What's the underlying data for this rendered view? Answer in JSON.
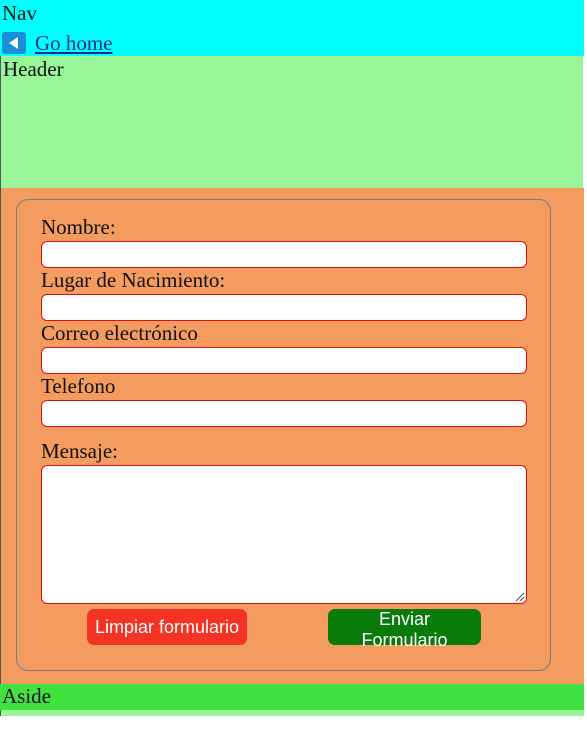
{
  "nav": {
    "title": "Nav",
    "home_link": {
      "icon": "back-arrow-icon",
      "label": "Go home"
    }
  },
  "header": {
    "title": "Header"
  },
  "form": {
    "fields": [
      {
        "label": "Nombre:",
        "value": ""
      },
      {
        "label": "Lugar de Nacimiento:",
        "value": ""
      },
      {
        "label": "Correo electrónico",
        "value": ""
      },
      {
        "label": "Telefono",
        "value": ""
      }
    ],
    "message": {
      "label": "Mensaje:",
      "value": ""
    },
    "buttons": {
      "clear_label": "Limpiar formulario",
      "send_label": "Enviar Formulario"
    }
  },
  "aside": {
    "title": "Aside"
  },
  "colors": {
    "nav_bg": "#00ffff",
    "header_bg": "#98f698",
    "main_bg": "#f49b5f",
    "aside_bg": "#42e142",
    "input_border": "#e01010",
    "clear_button": "#f43324",
    "send_button": "#0a7a0a",
    "link": "#1f2a8f"
  }
}
